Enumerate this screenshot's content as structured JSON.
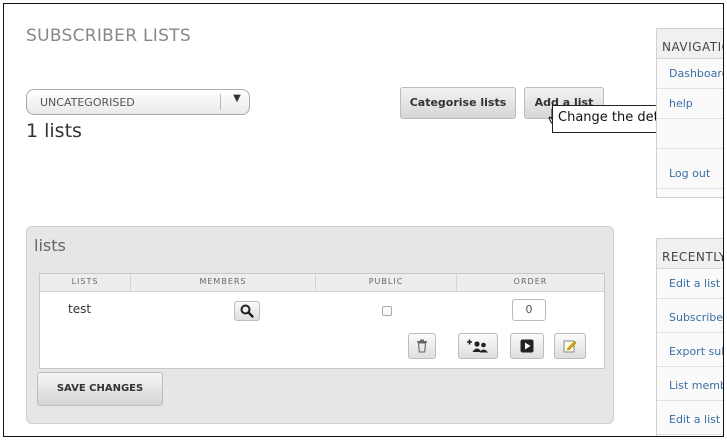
{
  "page": {
    "title": "SUBSCRIBER LISTS",
    "category_select": {
      "value": "UNCATEGORISED"
    },
    "categorise_button": "Categorise lists",
    "add_button": "Add a list",
    "tooltip": "Change the details for a list",
    "list_count": "1 lists"
  },
  "panel": {
    "title": "lists",
    "columns": [
      "LISTS",
      "MEMBERS",
      "PUBLIC",
      "ORDER"
    ],
    "rows": [
      {
        "name": "test",
        "public": false,
        "order": "0"
      }
    ],
    "save_button": "SAVE CHANGES"
  },
  "sidebar": {
    "navigation": {
      "title": "NAVIGATION",
      "links": [
        "Dashboard",
        "help",
        "",
        "Log out"
      ]
    },
    "recent": {
      "title": "RECENTLY VISITED",
      "links": [
        "Edit a list",
        "Subscribers",
        "Export subscribers",
        "List members",
        "Edit a list"
      ]
    }
  },
  "colors": {
    "link": "#3a6ea5",
    "panel_bg": "#e6e6e6"
  },
  "icons": [
    "chevron-down-icon",
    "zoom-icon",
    "trash-icon",
    "add-members-icon",
    "view-icon",
    "edit-icon",
    "mouse-pointer-icon"
  ]
}
